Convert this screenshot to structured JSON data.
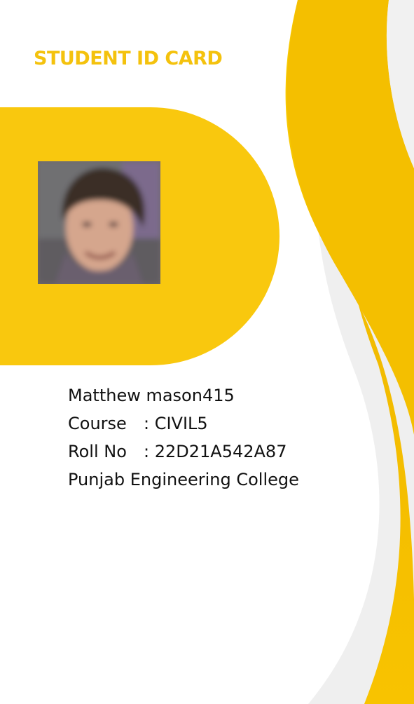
{
  "card": {
    "title": "STUDENT ID CARD",
    "photo_icon": "student-portrait",
    "name": "Matthew mason415",
    "course_label": "Course",
    "course_value": ": CIVIL5",
    "roll_label": "Roll No",
    "roll_value": ": 22D21A542A87",
    "college": "Punjab Engineering College"
  },
  "colors": {
    "accent": "#f9c80e",
    "accent_dark": "#f0b800",
    "title": "#f4c20d",
    "background": "#ffffff",
    "text": "#111111",
    "wave_shadow": "#ededed"
  }
}
